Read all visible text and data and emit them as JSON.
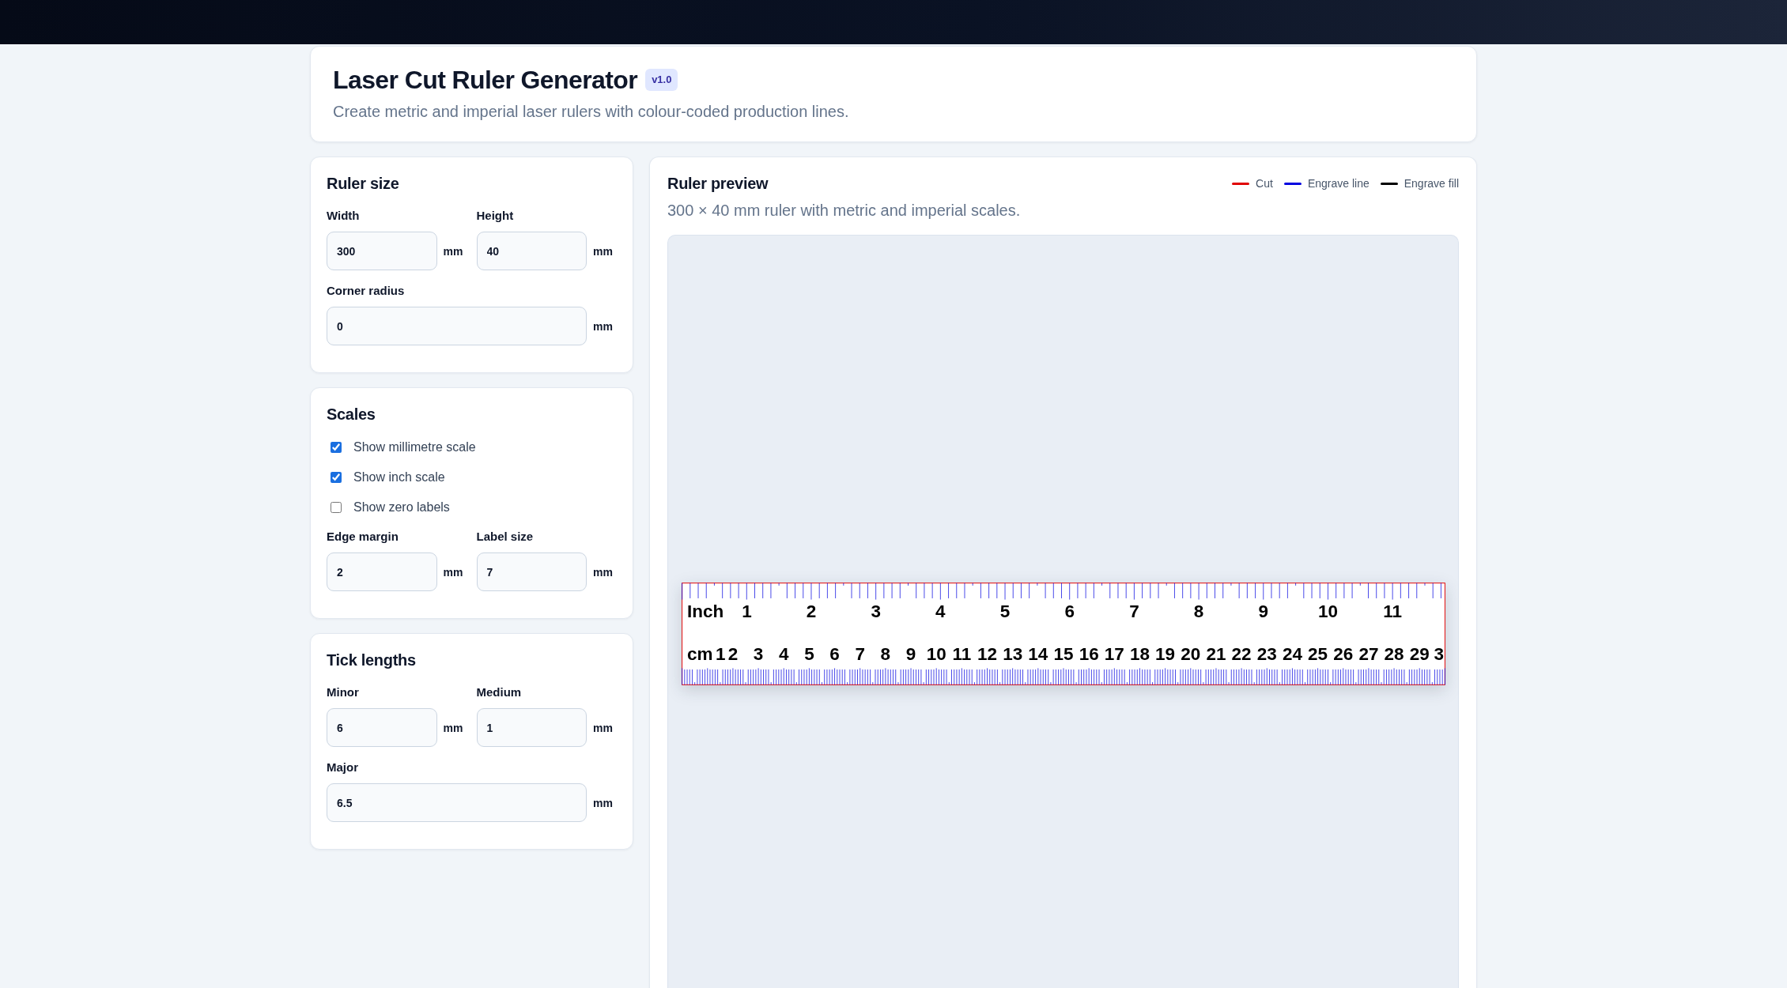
{
  "header": {
    "title": "Laser Cut Ruler Generator",
    "badge": "v1.0",
    "subtitle": "Create metric and imperial laser rulers with colour-coded production lines."
  },
  "settings_panels": [
    {
      "title": "Ruler size",
      "blocks": [
        {
          "kind": "fields",
          "fields": [
            {
              "label": "Width",
              "value": "300",
              "unit": "mm"
            },
            {
              "label": "Height",
              "value": "40",
              "unit": "mm"
            }
          ]
        },
        {
          "kind": "fields",
          "fields": [
            {
              "label": "Corner radius",
              "value": "0",
              "unit": "mm"
            }
          ]
        }
      ]
    },
    {
      "title": "Scales",
      "blocks": [
        {
          "kind": "checkbox",
          "label": "Show millimetre scale",
          "checked": true
        },
        {
          "kind": "checkbox",
          "label": "Show inch scale",
          "checked": true
        },
        {
          "kind": "checkbox",
          "label": "Show zero labels",
          "checked": false
        },
        {
          "kind": "fields",
          "fields": [
            {
              "label": "Edge margin",
              "value": "2",
              "unit": "mm"
            },
            {
              "label": "Label size",
              "value": "7",
              "unit": "mm"
            }
          ]
        }
      ]
    },
    {
      "title": "Tick lengths",
      "blocks": [
        {
          "kind": "fields",
          "fields": [
            {
              "label": "Minor",
              "value": "6",
              "unit": "mm"
            },
            {
              "label": "Medium",
              "value": "1",
              "unit": "mm"
            }
          ]
        },
        {
          "kind": "fields",
          "fields": [
            {
              "label": "Major",
              "value": "6.5",
              "unit": "mm"
            }
          ]
        }
      ]
    }
  ],
  "preview": {
    "title": "Ruler preview",
    "description": "300 × 40 mm ruler with metric and imperial scales.",
    "legend": [
      {
        "kind": "cut",
        "label": "Cut",
        "color": "#e00000"
      },
      {
        "kind": "engrave_line",
        "label": "Engrave line",
        "color": "#0000e0"
      },
      {
        "kind": "engrave_fill",
        "label": "Engrave fill",
        "color": "#000000"
      }
    ],
    "ruler": {
      "scales": [
        {
          "kind": "inch",
          "label": "Inch",
          "numbers": [
            "1",
            "2",
            "3",
            "4",
            "5",
            "6",
            "7",
            "8",
            "9",
            "10",
            "11"
          ]
        },
        {
          "kind": "cm",
          "label": "cm",
          "numbers": [
            "1",
            "2",
            "3",
            "4",
            "5",
            "6",
            "7",
            "8",
            "9",
            "10",
            "11",
            "12",
            "13",
            "14",
            "15",
            "16",
            "17",
            "18",
            "19",
            "20",
            "21",
            "22",
            "23",
            "24",
            "25",
            "26",
            "27",
            "28",
            "29",
            "3"
          ]
        }
      ]
    }
  }
}
